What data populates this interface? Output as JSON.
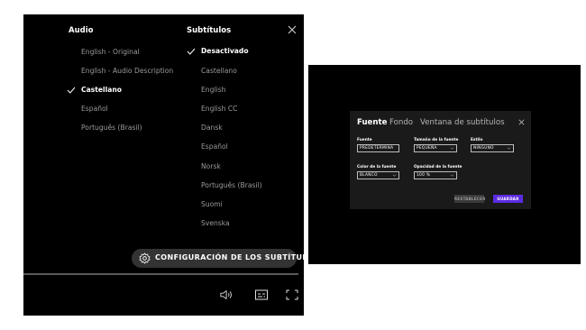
{
  "player": {
    "audio_heading": "Audio",
    "subtitles_heading": "Subtítulos",
    "audio_options": [
      {
        "label": "English - Original",
        "selected": false
      },
      {
        "label": "English - Audio Description",
        "selected": false
      },
      {
        "label": "Castellano",
        "selected": true
      },
      {
        "label": "Español",
        "selected": false
      },
      {
        "label": "Português (Brasil)",
        "selected": false
      }
    ],
    "subtitle_options": [
      {
        "label": "Desactivado",
        "selected": true
      },
      {
        "label": "Castellano",
        "selected": false
      },
      {
        "label": "English",
        "selected": false
      },
      {
        "label": "English CC",
        "selected": false
      },
      {
        "label": "Dansk",
        "selected": false
      },
      {
        "label": "Español",
        "selected": false
      },
      {
        "label": "Norsk",
        "selected": false
      },
      {
        "label": "Português (Brasil)",
        "selected": false
      },
      {
        "label": "Suomi",
        "selected": false
      },
      {
        "label": "Svenska",
        "selected": false
      }
    ],
    "settings_button_label": "CONFIGURACIÓN DE LOS SUBTÍTULOS",
    "icons": {
      "close": "close-icon",
      "check": "check-icon",
      "gear": "gear-icon",
      "volume": "volume-icon",
      "subtitles": "subtitles-icon",
      "fullscreen": "fullscreen-icon"
    }
  },
  "settings_dialog": {
    "tabs": [
      {
        "label": "Fuente",
        "active": true
      },
      {
        "label": "Fondo",
        "active": false
      },
      {
        "label": "Ventana de subtítulos",
        "active": false
      }
    ],
    "fields": {
      "font": {
        "label": "Fuente",
        "value": "PREDETERMINA"
      },
      "font_size": {
        "label": "Tamaño de la fuente",
        "value": "PEQUEÑA"
      },
      "style": {
        "label": "Estilo",
        "value": "NINGUNO"
      },
      "font_color": {
        "label": "Color de la fuente",
        "value": "BLANCO"
      },
      "opacity": {
        "label": "Opacidad de la fuente",
        "value": "100 %"
      }
    },
    "reset_label": "RESTABLECER",
    "save_label": "GUARDAR",
    "colors": {
      "save": "#5b2be0",
      "panel": "#1a1a1a",
      "background": "#000000"
    }
  }
}
